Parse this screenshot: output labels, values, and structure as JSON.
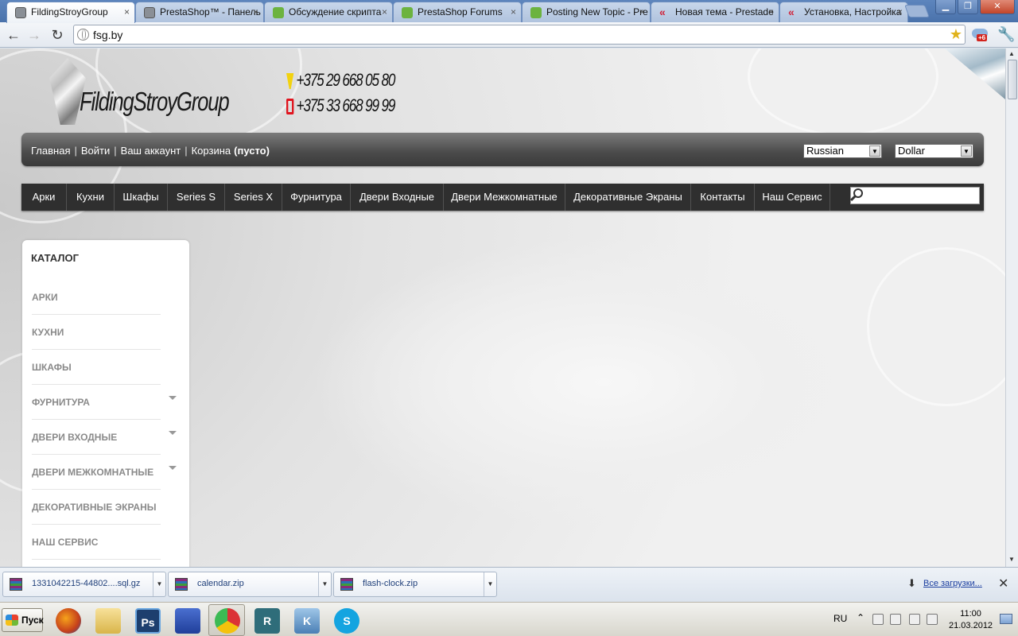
{
  "browser": {
    "tabs": [
      {
        "title": "FildingStroyGroup",
        "favicon": "prestashop-icon",
        "active": true
      },
      {
        "title": "PrestaShop™ - Панель",
        "favicon": "prestashop-icon",
        "active": false
      },
      {
        "title": "Обсуждение скрипта",
        "favicon": "prestashop-forum-icon",
        "active": false
      },
      {
        "title": "PrestaShop Forums",
        "favicon": "prestashop-forum-icon",
        "active": false
      },
      {
        "title": "Posting New Topic - Pre",
        "favicon": "prestashop-forum-icon",
        "active": false
      },
      {
        "title": "Новая тема - Prestade",
        "favicon": "prestadev-icon",
        "active": false
      },
      {
        "title": "Установка, Настройка",
        "favicon": "prestadev-icon",
        "active": false
      }
    ],
    "tab_close_glyph": "×",
    "url": "fsg.by",
    "extension_badge": "+6"
  },
  "site": {
    "brand": "FildingStroyGroup",
    "phones": [
      "+375 29 668 05 80",
      "+375 33 668 99 99"
    ],
    "userlinks": {
      "home": "Главная",
      "login": "Войти",
      "account": "Ваш аккаунт",
      "cart": "Корзина",
      "cart_status": "(пусто)"
    },
    "language_select": "Russian",
    "currency_select": "Dollar",
    "menu": [
      "Арки",
      "Кухни",
      "Шкафы",
      "Series S",
      "Series X",
      "Фурнитура",
      "Двери Входные",
      "Двери Межкомнатные",
      "Декоративные Экраны",
      "Контакты",
      "Наш Сервис"
    ],
    "search_value": "",
    "catalog": {
      "title": "КАТАЛОГ",
      "items": [
        {
          "label": "АРКИ",
          "has_children": false
        },
        {
          "label": "КУХНИ",
          "has_children": false
        },
        {
          "label": "ШКАФЫ",
          "has_children": false
        },
        {
          "label": "ФУРНИТУРА",
          "has_children": true
        },
        {
          "label": "ДВЕРИ ВХОДНЫЕ",
          "has_children": true
        },
        {
          "label": "ДВЕРИ МЕЖКОМНАТНЫЕ",
          "has_children": true
        },
        {
          "label": "ДЕКОРАТИВНЫЕ ЭКРАНЫ",
          "has_children": false
        },
        {
          "label": "НАШ СЕРВИС",
          "has_children": false
        }
      ]
    }
  },
  "downloads": {
    "files": [
      "1331042215-44802....sql.gz",
      "calendar.zip",
      "flash-clock.zip"
    ],
    "all_link": "Все загрузки..."
  },
  "taskbar": {
    "start_label": "Пуск",
    "apps": [
      "firefox-icon",
      "folder-icon",
      "photoshop-icon",
      "save-disk-icon",
      "chrome-icon",
      "rpc-icon",
      "koala-icon",
      "skype-icon"
    ],
    "active_app": "chrome-icon",
    "language": "RU",
    "time": "11:00",
    "date": "21.03.2012"
  },
  "colors": {
    "menu_bg": "#2f2f2f",
    "topbar_bg": "#4a4a4a",
    "catalog_text": "#8a8a8a",
    "chrome_frame": "#4a72ab"
  }
}
